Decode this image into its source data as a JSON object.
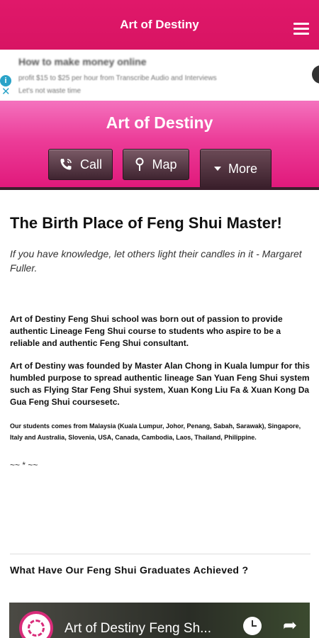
{
  "appbar": {
    "title": "Art of Destiny",
    "menu_icon": "hamburger-menu-icon"
  },
  "ad": {
    "title": "How to make money online",
    "description_line1": "profit $15 to $25 per hour from Transcribe Audio and Interviews",
    "description_line2": "Let's not waste time",
    "info_icon": "i",
    "close_icon": "✕"
  },
  "hero": {
    "title": "Art of Destiny",
    "buttons": {
      "call": "Call",
      "map": "Map",
      "more": "More"
    }
  },
  "content": {
    "headline": "The Birth Place of Feng Shui Master!",
    "quote": "If you have knowledge, let others light their candles in it - Margaret Fuller.",
    "paragraph1": "Art of Destiny Feng Shui school was born out of passion to provide authentic Lineage Feng Shui course to students who aspire to be a reliable and authentic Feng Shui consultant.",
    "paragraph2": "Art of Destiny was founded by Master Alan Chong in Kuala lumpur for this humbled purpose to spread authentic lineage San Yuan Feng Shui system such as Flying Star Feng Shui system, Xuan Kong Liu Fa & Xuan Kong Da Gua Feng Shui coursesetc.",
    "paragraph3": "Our students comes from Malaysia (Kuala Lumpur, Johor, Penang, Sabah, Sarawak), Singapore, Italy and Australia, Slovenia, USA, Canada, Cambodia, Laos, Thailand, Philippine.",
    "ornament": "~~ * ~~",
    "subhead": "What Have Our Feng Shui Graduates Achieved ?"
  },
  "video": {
    "title": "Art of Destiny Feng Sh..."
  }
}
